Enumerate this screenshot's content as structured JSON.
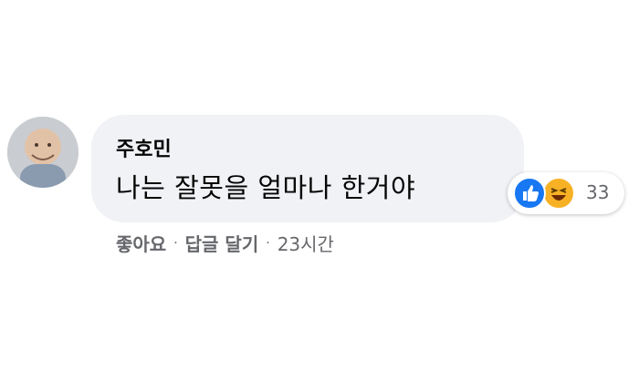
{
  "comment": {
    "author": "주호민",
    "text": "나는 잘못을 얼마나 한거야",
    "reactions": {
      "icons": [
        "like-icon",
        "haha-icon"
      ],
      "count": "33",
      "like_color": "#1877f2",
      "haha_color": "#f7b125"
    },
    "actions": {
      "like": "좋아요",
      "reply": "답글 달기",
      "time": "23시간",
      "separator": "·"
    }
  }
}
